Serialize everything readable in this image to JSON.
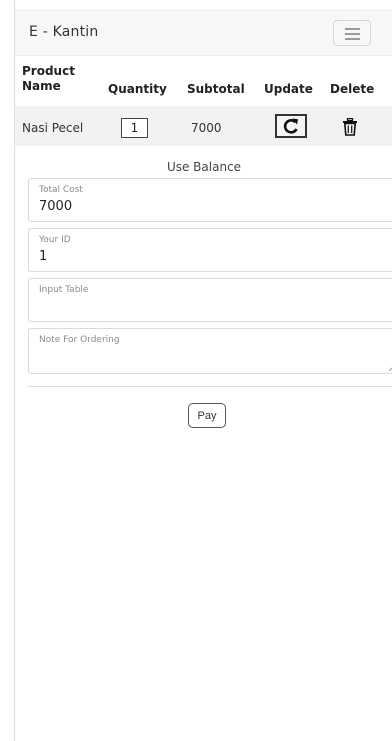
{
  "navbar": {
    "brand": "E - Kantin",
    "menu_icon": "hamburger-icon"
  },
  "cart": {
    "headers": {
      "product_name": [
        "Product",
        "Name"
      ],
      "quantity": "Quantity",
      "subtotal": "Subtotal",
      "update": "Update",
      "delete": "Delete"
    },
    "rows": [
      {
        "product_name": "Nasi Pecel",
        "quantity": "1",
        "subtotal": "7000",
        "update_icon": "refresh-icon",
        "delete_icon": "trash-icon"
      }
    ]
  },
  "payment_method": "Use Balance",
  "form": {
    "total_cost": {
      "label": "Total Cost",
      "value": "7000"
    },
    "your_id": {
      "label": "Your ID",
      "value": "1"
    },
    "input_table": {
      "placeholder": "Input Table",
      "value": ""
    },
    "note": {
      "placeholder": "Note For Ordering",
      "value": ""
    }
  },
  "pay_label": "Pay"
}
